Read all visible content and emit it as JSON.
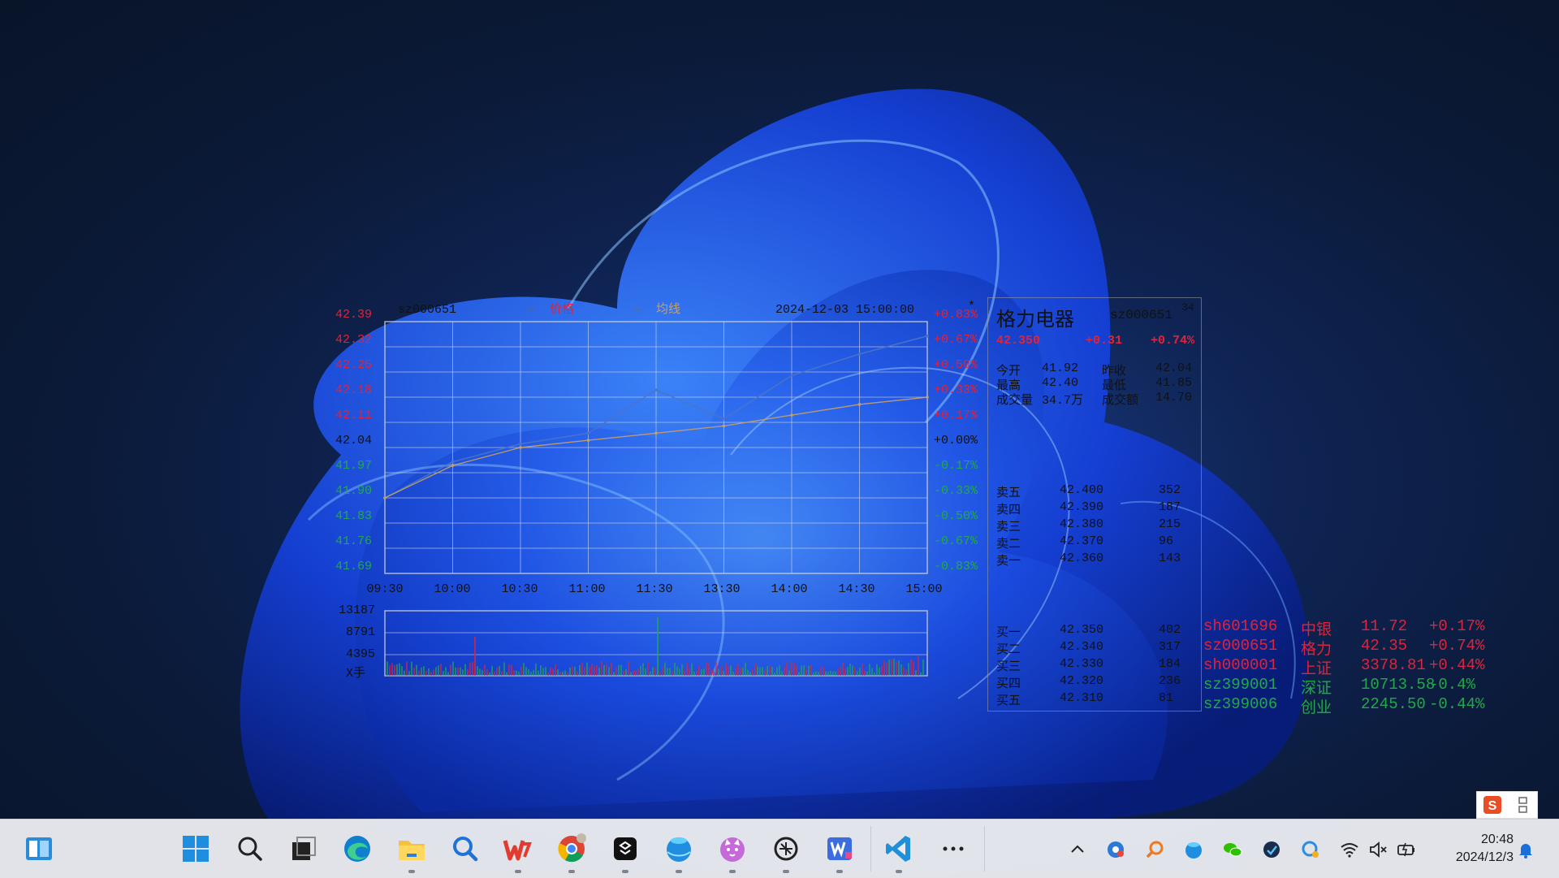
{
  "colors": {
    "up": "#e0233a",
    "down": "#22a84a",
    "flat": "#111111",
    "avg_line": "#c8a066",
    "price_line": "#4a74c8"
  },
  "stock_widget": {
    "header": {
      "symbol": "sz000651",
      "legend_price": "价格",
      "legend_avg": "均线",
      "timestamp": "2024-12-03 15:00:00",
      "corner_mark": "*"
    },
    "price_axis": [
      "42.39",
      "42.32",
      "42.25",
      "42.18",
      "42.11",
      "42.04",
      "41.97",
      "41.90",
      "41.83",
      "41.76",
      "41.69"
    ],
    "pct_axis": [
      "+0.83%",
      "+0.67%",
      "+0.50%",
      "+0.33%",
      "+0.17%",
      "+0.00%",
      "-0.17%",
      "-0.33%",
      "-0.50%",
      "-0.67%",
      "-0.83%"
    ],
    "time_axis": [
      "09:30",
      "10:00",
      "10:30",
      "11:00",
      "11:30",
      "13:30",
      "14:00",
      "14:30",
      "15:00"
    ],
    "volume_axis": [
      "13187",
      "8791",
      "4395"
    ],
    "volume_unit": "X手"
  },
  "chart_data": {
    "type": "line",
    "title": "sz000651",
    "x": [
      "09:30",
      "10:00",
      "10:30",
      "11:00",
      "11:30/13:00",
      "13:30",
      "14:00",
      "14:30",
      "15:00"
    ],
    "series": [
      {
        "name": "价格",
        "values": [
          41.9,
          42.0,
          42.05,
          42.08,
          42.2,
          42.12,
          42.24,
          42.3,
          42.35
        ]
      },
      {
        "name": "均线",
        "values": [
          41.9,
          41.99,
          42.04,
          42.06,
          42.08,
          42.1,
          42.13,
          42.16,
          42.18
        ]
      }
    ],
    "ylim": [
      41.69,
      42.39
    ],
    "grid": true
  },
  "detail_panel": {
    "name": "格力电器",
    "code": "sz000651",
    "corner": "34",
    "price": "42.350",
    "change": "+0.31",
    "change_pct": "+0.74%",
    "rows": [
      {
        "label": "今开",
        "value": "41.92",
        "label2": "昨收",
        "value2": "42.04"
      },
      {
        "label": "最高",
        "value": "42.40",
        "label2": "最低",
        "value2": "41.85"
      },
      {
        "label": "成交量",
        "value": "34.7万",
        "label2": "成交额",
        "value2": "14.70"
      }
    ],
    "asks": [
      {
        "label": "卖五",
        "price": "42.400",
        "vol": "352"
      },
      {
        "label": "卖四",
        "price": "42.390",
        "vol": "187"
      },
      {
        "label": "卖三",
        "price": "42.380",
        "vol": "215"
      },
      {
        "label": "卖二",
        "price": "42.370",
        "vol": "96"
      },
      {
        "label": "卖一",
        "price": "42.360",
        "vol": "143"
      }
    ],
    "bids": [
      {
        "label": "买一",
        "price": "42.350",
        "vol": "402"
      },
      {
        "label": "买二",
        "price": "42.340",
        "vol": "317"
      },
      {
        "label": "买三",
        "price": "42.330",
        "vol": "184"
      },
      {
        "label": "买四",
        "price": "42.320",
        "vol": "236"
      },
      {
        "label": "买五",
        "price": "42.310",
        "vol": "81"
      }
    ]
  },
  "watchlist": [
    {
      "code": "sh601696",
      "name": "中银",
      "price": "11.72",
      "pct": "+0.17%",
      "trend": "up"
    },
    {
      "code": "sz000651",
      "name": "格力",
      "price": "42.35",
      "pct": "+0.74%",
      "trend": "up"
    },
    {
      "code": "sh000001",
      "name": "上证",
      "price": "3378.81",
      "pct": "+0.44%",
      "trend": "up"
    },
    {
      "code": "sz399001",
      "name": "深证",
      "price": "10713.58",
      "pct": "-0.4%",
      "trend": "down"
    },
    {
      "code": "sz399006",
      "name": "创业",
      "price": "2245.50",
      "pct": "-0.44%",
      "trend": "down"
    }
  ],
  "taskbar": {
    "apps": [
      "widgets",
      "start",
      "search",
      "task-view",
      "edge",
      "file-explorer",
      "everything-search",
      "wps",
      "chrome",
      "typora",
      "browser-alt",
      "cat-app",
      "chatgpt",
      "word-app",
      "vscode",
      "more-apps"
    ],
    "tray": [
      "show-hidden",
      "app-tray-1",
      "search-tool",
      "browser-tray",
      "wechat",
      "app-tray-2",
      "app-tray-3",
      "wifi",
      "volume-muted",
      "battery"
    ],
    "time": "20:48",
    "date": "2024/12/3"
  }
}
